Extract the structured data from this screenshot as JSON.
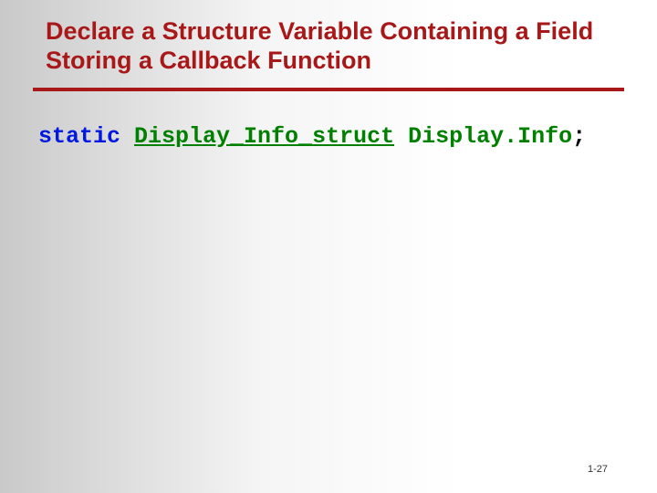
{
  "slide": {
    "title": "Declare a Structure Variable Containing a Field Storing a Callback Function",
    "code": {
      "keyword": "static",
      "type": "Display_Info_struct",
      "variable": "Display.Info",
      "terminator": ";"
    },
    "footer": "1-27"
  }
}
